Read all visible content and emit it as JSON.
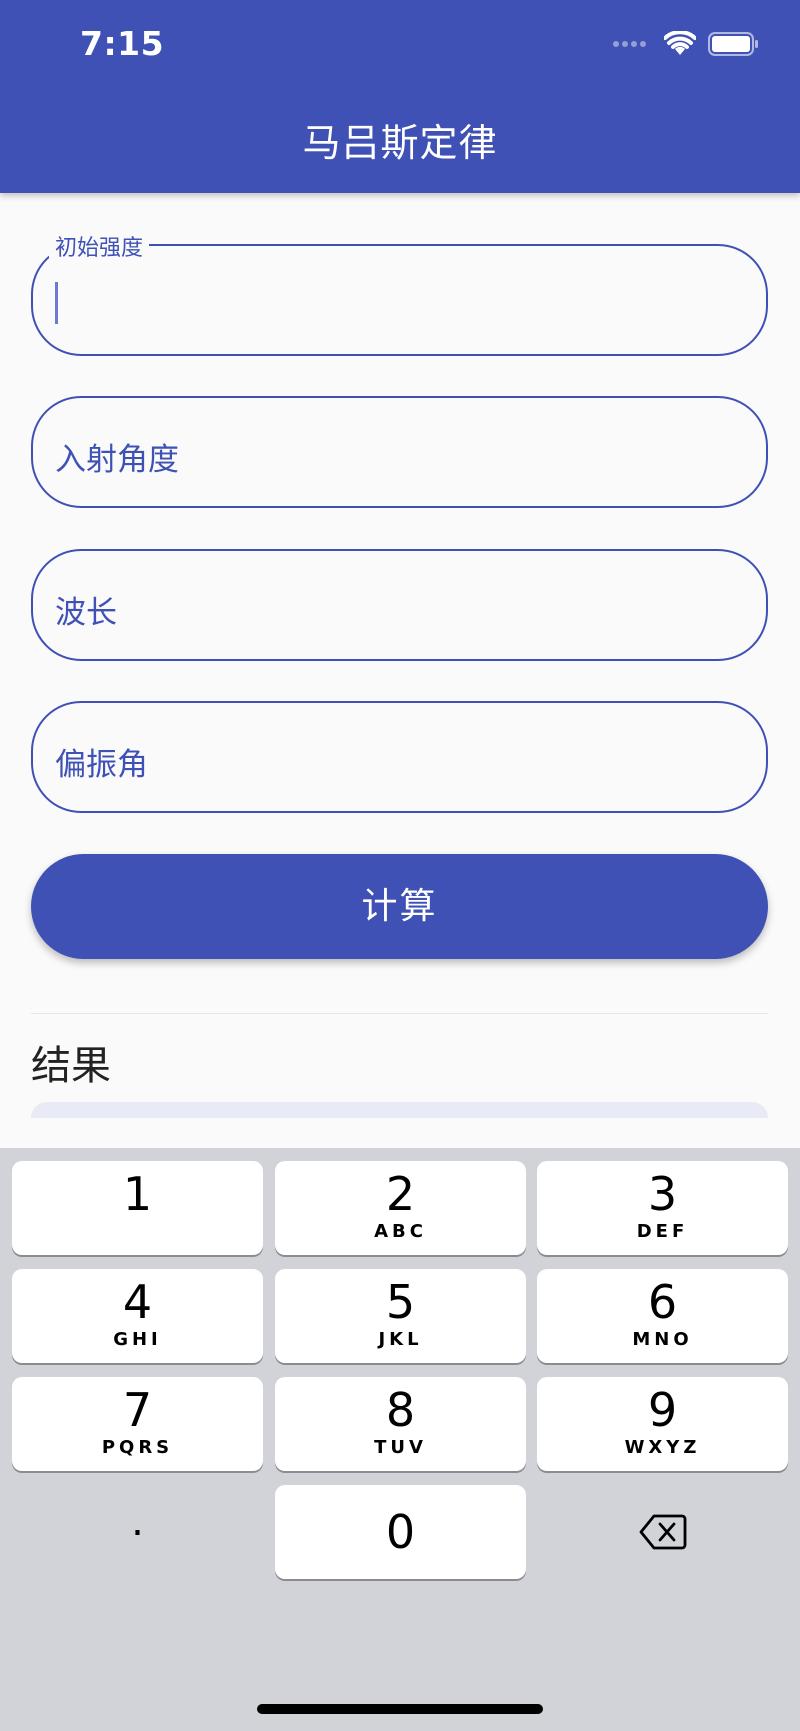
{
  "status_bar": {
    "time": "7:15"
  },
  "app_bar": {
    "title": "马吕斯定律"
  },
  "form": {
    "initial_intensity": {
      "label": "初始强度",
      "value": ""
    },
    "incident_angle": {
      "label": "入射角度"
    },
    "wavelength": {
      "label": "波长"
    },
    "polarization_angle": {
      "label": "偏振角"
    }
  },
  "calculate_button": {
    "label": "计算"
  },
  "result": {
    "title": "结果"
  },
  "keypad": {
    "keys": [
      {
        "num": "1",
        "letters": ""
      },
      {
        "num": "2",
        "letters": "ABC"
      },
      {
        "num": "3",
        "letters": "DEF"
      },
      {
        "num": "4",
        "letters": "GHI"
      },
      {
        "num": "5",
        "letters": "JKL"
      },
      {
        "num": "6",
        "letters": "MNO"
      },
      {
        "num": "7",
        "letters": "PQRS"
      },
      {
        "num": "8",
        "letters": "TUV"
      },
      {
        "num": "9",
        "letters": "WXYZ"
      }
    ],
    "decimal": ".",
    "zero": "0",
    "backspace_icon": "delete-left-icon"
  },
  "colors": {
    "primary": "#3f51b5",
    "background": "#fafafa",
    "keyboard_bg": "#d1d3d9"
  }
}
